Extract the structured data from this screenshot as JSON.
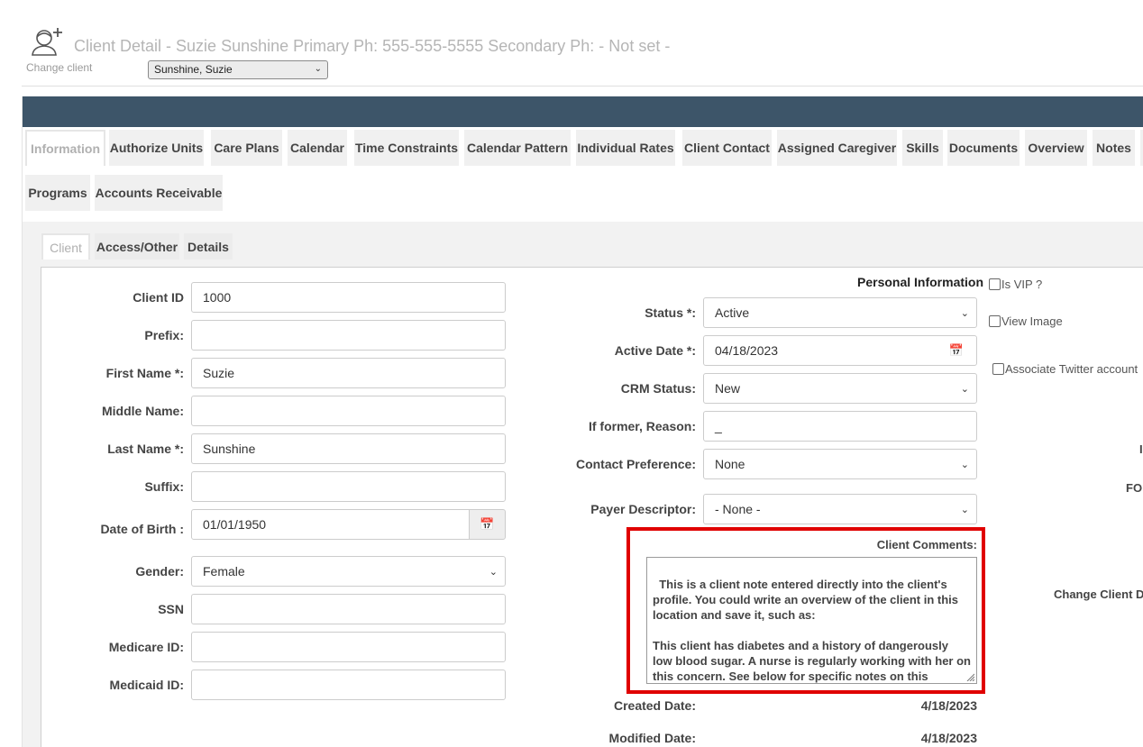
{
  "header": {
    "title": "Client Detail - Suzie Sunshine Primary Ph: 555-555-5555 Secondary Ph: - Not set -",
    "change_client_label": "Change client",
    "client_select_value": "Sunshine, Suzie"
  },
  "main_tabs": [
    {
      "label": "Information",
      "active": true
    },
    {
      "label": "Authorize Units"
    },
    {
      "label": "Care Plans"
    },
    {
      "label": "Calendar"
    },
    {
      "label": "Time Constraints"
    },
    {
      "label": "Calendar Pattern"
    },
    {
      "label": "Individual Rates"
    },
    {
      "label": "Client Contact"
    },
    {
      "label": "Assigned Caregiver"
    },
    {
      "label": "Skills"
    },
    {
      "label": "Documents"
    },
    {
      "label": "Overview"
    },
    {
      "label": "Notes"
    },
    {
      "label": "Programs"
    },
    {
      "label": "Accounts Receivable"
    }
  ],
  "sub_tabs": [
    {
      "label": "Client",
      "active": true
    },
    {
      "label": "Access/Other"
    },
    {
      "label": "Details"
    }
  ],
  "left_form": {
    "client_id": {
      "label": "Client ID",
      "value": "1000"
    },
    "prefix": {
      "label": "Prefix:",
      "value": ""
    },
    "first_name": {
      "label": "First Name *:",
      "value": "Suzie"
    },
    "middle_name": {
      "label": "Middle Name:",
      "value": ""
    },
    "last_name": {
      "label": "Last Name *:",
      "value": "Sunshine"
    },
    "suffix": {
      "label": "Suffix:",
      "value": ""
    },
    "dob": {
      "label": "Date of Birth :",
      "value": "01/01/1950"
    },
    "gender": {
      "label": "Gender:",
      "value": "Female"
    },
    "ssn": {
      "label": "SSN",
      "value": ""
    },
    "medicare": {
      "label": "Medicare ID:",
      "value": ""
    },
    "medicaid": {
      "label": "Medicaid ID:",
      "value": ""
    }
  },
  "personal_info": {
    "section_title": "Personal Information",
    "status": {
      "label": "Status *:",
      "value": "Active"
    },
    "active_date": {
      "label": "Active Date *:",
      "value": "04/18/2023"
    },
    "crm_status": {
      "label": "CRM Status:",
      "value": "New"
    },
    "former_reason": {
      "label": "If former, Reason:",
      "value": "_"
    },
    "contact_pref": {
      "label": "Contact Preference:",
      "value": "None"
    },
    "payer_descriptor": {
      "label": "Payer Descriptor:",
      "value": "- None -"
    },
    "comments_label": "Client Comments:",
    "comments_text": "This is a client note entered directly into the client's profile. You could write an overview of the client in this location and save it, such as:\n\nThis client has diabetes and a history of dangerously low blood sugar. A nurse is regularly working with her on this concern. See below for specific notes on this history.",
    "created_date": {
      "label": "Created Date:",
      "value": "4/18/2023"
    },
    "modified_date": {
      "label": "Modified Date:",
      "value": "4/18/2023"
    }
  },
  "right_options": {
    "is_vip": "Is VIP ?",
    "view_image": "View Image",
    "associate_twitter": "Associate Twitter account",
    "clipped_fo": "FO",
    "clipped_change_client": "Change Client D",
    "clipped_i": "I"
  },
  "colors": {
    "navbar": "#3d5569",
    "highlight": "#e00000"
  }
}
